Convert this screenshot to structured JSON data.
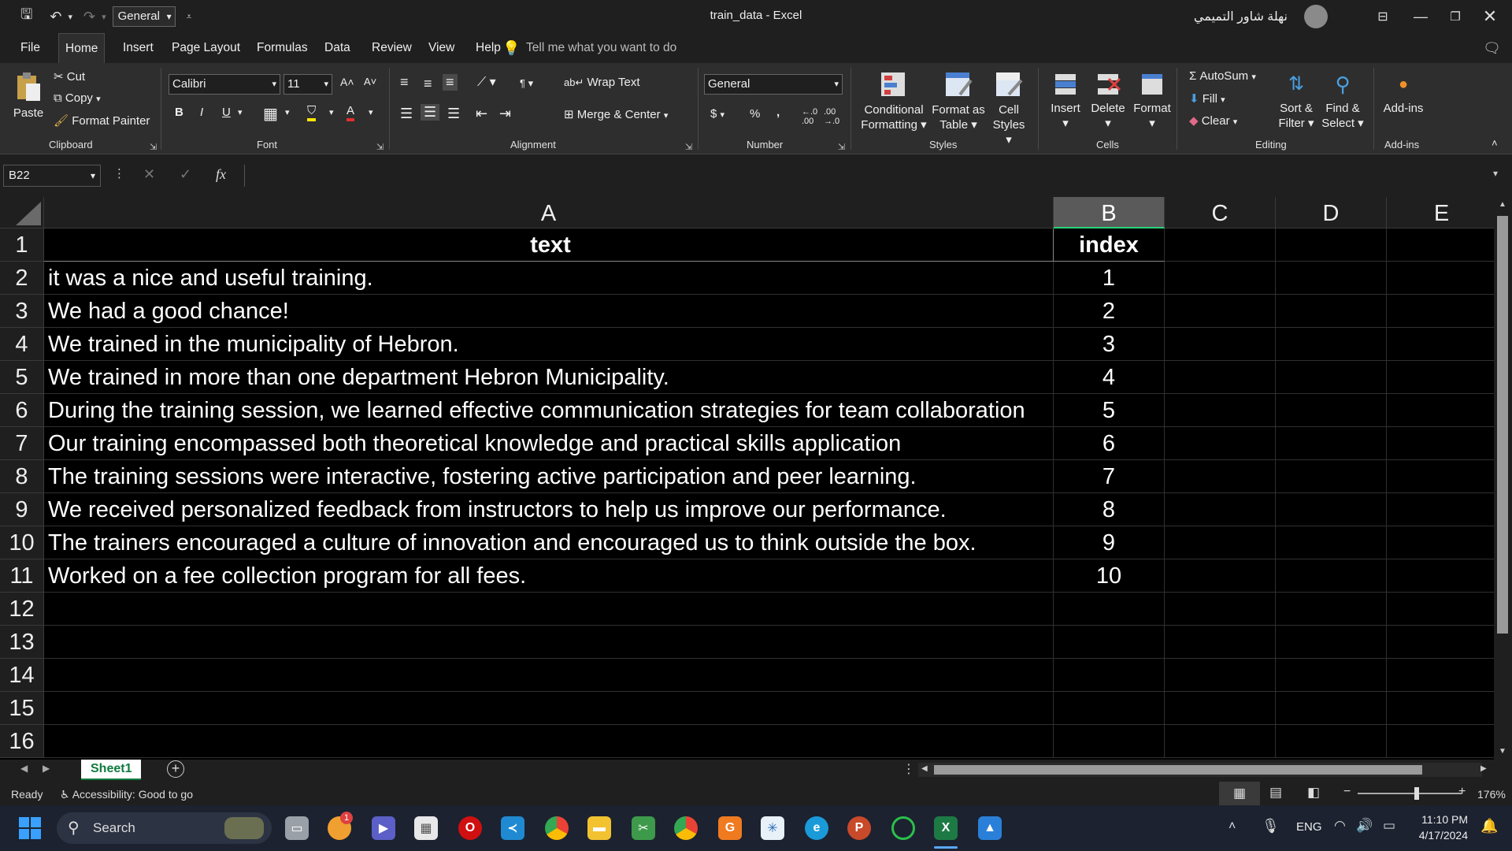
{
  "titlebar": {
    "style_value": "General",
    "doc_title": "train_data  -  Excel",
    "user_name": "نهلة شاور التميمي"
  },
  "menu": {
    "items": [
      "File",
      "Home",
      "Insert",
      "Page Layout",
      "Formulas",
      "Data",
      "Review",
      "View",
      "Help"
    ],
    "active": "Home",
    "tell_me": "Tell me what you want to do"
  },
  "ribbon": {
    "clipboard": {
      "paste": "Paste",
      "cut": "Cut",
      "copy": "Copy",
      "format_painter": "Format Painter",
      "label": "Clipboard"
    },
    "font": {
      "name": "Calibri",
      "size": "11",
      "bold": "B",
      "italic": "I",
      "underline": "U",
      "label": "Font"
    },
    "alignment": {
      "wrap_text": "Wrap Text",
      "merge_center": "Merge & Center",
      "label": "Alignment"
    },
    "number": {
      "format": "General",
      "currency": "$",
      "percent": "%",
      "comma": ",",
      "label": "Number"
    },
    "styles": {
      "conditional_1": "Conditional",
      "conditional_2": "Formatting",
      "format_table_1": "Format as",
      "format_table_2": "Table",
      "cell_styles_1": "Cell",
      "cell_styles_2": "Styles",
      "label": "Styles"
    },
    "cells": {
      "insert": "Insert",
      "delete": "Delete",
      "format": "Format",
      "label": "Cells"
    },
    "editing": {
      "autosum": "AutoSum",
      "fill": "Fill",
      "clear": "Clear",
      "sort_1": "Sort &",
      "sort_2": "Filter",
      "find_1": "Find &",
      "find_2": "Select",
      "label": "Editing"
    },
    "addins": {
      "addins": "Add-ins",
      "label": "Add-ins"
    }
  },
  "formula_bar": {
    "name_box": "B22",
    "fx": "fx",
    "formula": ""
  },
  "sheet": {
    "columns": [
      "A",
      "B",
      "C",
      "D",
      "E"
    ],
    "selected_column": "B",
    "rows": [
      "1",
      "2",
      "3",
      "4",
      "5",
      "6",
      "7",
      "8",
      "9",
      "10",
      "11",
      "12",
      "13",
      "14",
      "15",
      "16"
    ],
    "header": {
      "a": "text",
      "b": "index"
    },
    "data": [
      {
        "text": "it was a nice and useful training.",
        "index": "1"
      },
      {
        "text": "We had a good chance!",
        "index": "2"
      },
      {
        "text": "We trained in the municipality of Hebron.",
        "index": "3"
      },
      {
        "text": "We trained in more than one department Hebron Municipality.",
        "index": "4"
      },
      {
        "text": "During the training session, we learned effective communication strategies for team collaboration",
        "index": "5"
      },
      {
        "text": "Our training encompassed both theoretical knowledge and practical skills application",
        "index": "6"
      },
      {
        "text": "The training sessions were interactive, fostering active participation and peer learning.",
        "index": "7"
      },
      {
        "text": "We received personalized feedback from instructors to help us improve our performance.",
        "index": "8"
      },
      {
        "text": "The trainers encouraged a culture of innovation and encouraged us to think outside the box.",
        "index": "9"
      },
      {
        "text": "Worked on a fee collection program for all fees.",
        "index": "10"
      }
    ],
    "tab_name": "Sheet1"
  },
  "status": {
    "ready": "Ready",
    "accessibility": "Accessibility: Good to go",
    "zoom": "176%"
  },
  "taskbar": {
    "search": "Search",
    "badge": "1",
    "lang": "ENG",
    "time": "11:10 PM",
    "date": "4/17/2024"
  }
}
